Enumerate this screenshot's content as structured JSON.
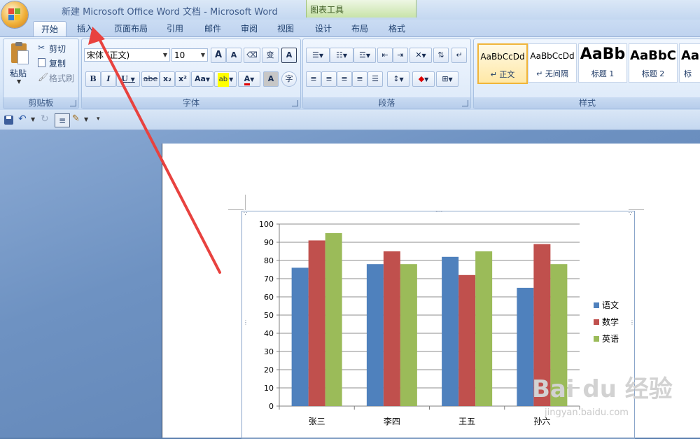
{
  "window": {
    "title": "新建 Microsoft Office Word 文档 - Microsoft Word",
    "tool_tab_group": "图表工具"
  },
  "tabs": [
    "开始",
    "插入",
    "页面布局",
    "引用",
    "邮件",
    "审阅",
    "视图",
    "设计",
    "布局",
    "格式"
  ],
  "active_tab": "开始",
  "clipboard": {
    "paste": "粘贴",
    "cut": "剪切",
    "copy": "复制",
    "format_painter": "格式刷",
    "label": "剪贴板"
  },
  "font": {
    "name_value": "宋体 (正文)",
    "size_value": "10",
    "bold": "B",
    "italic": "I",
    "underline": "U",
    "strike": "abe",
    "subscript": "x₂",
    "superscript": "x²",
    "change_case": "Aa",
    "grow": "A",
    "shrink": "A",
    "font_color": "A",
    "char_shading": "A",
    "enclose": "字",
    "phonetic": "变",
    "border": "A",
    "label": "字体"
  },
  "paragraph": {
    "label": "段落"
  },
  "styles": {
    "items": [
      {
        "sample": "AaBbCcDd",
        "name": "↵ 正文"
      },
      {
        "sample": "AaBbCcDd",
        "name": "↵ 无间隔"
      },
      {
        "sample": "AaBb",
        "name": "标题 1"
      },
      {
        "sample": "AaBbC",
        "name": "标题 2"
      },
      {
        "sample": "AaI",
        "name": "标"
      }
    ],
    "label": "样式"
  },
  "colors": {
    "accent_arrow": "#e8423f",
    "series_blue": "#4f81bd",
    "series_red": "#c0504d",
    "series_green": "#9bbb59"
  },
  "chart_data": {
    "type": "bar",
    "categories": [
      "张三",
      "李四",
      "王五",
      "孙六"
    ],
    "series": [
      {
        "name": "语文",
        "values": [
          76,
          78,
          82,
          65
        ]
      },
      {
        "name": "数学",
        "values": [
          91,
          85,
          72,
          89
        ]
      },
      {
        "name": "英语",
        "values": [
          95,
          78,
          85,
          78
        ]
      }
    ],
    "ylim": [
      0,
      100
    ],
    "yticks": [
      0,
      10,
      20,
      30,
      40,
      50,
      60,
      70,
      80,
      90,
      100
    ],
    "grid": true,
    "legend": "right"
  },
  "watermark": {
    "main": "Bai du 经验",
    "sub": "jingyan.baidu.com"
  }
}
